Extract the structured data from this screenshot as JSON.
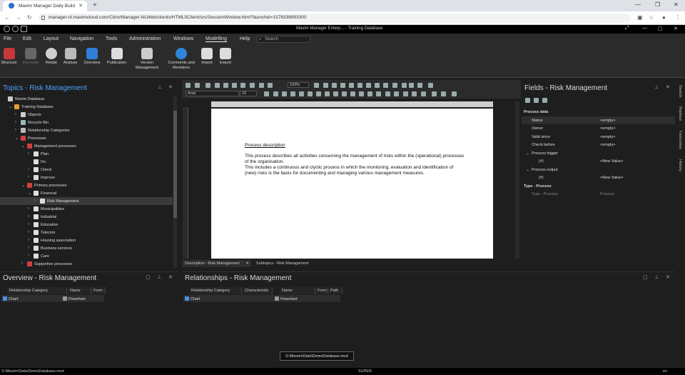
{
  "browser": {
    "tab_title": "Mavim Manager Daily Build",
    "url": "manager-nl.mavimcloud.com/Citrix/Manager-NLWeb/clients/HTML5Client/src/SessionWindow.html?launchid=1578338993300"
  },
  "app": {
    "title": "Mavim Manager Enterp... - Training Database",
    "menu": [
      "File",
      "Edit",
      "Layout",
      "Navigation",
      "Tools",
      "Administration",
      "Windows",
      "Modelling",
      "Help"
    ],
    "active_menu": "Modelling",
    "search_placeholder": "Search",
    "ribbon": [
      {
        "label": "Structure",
        "has_menu": true
      },
      {
        "label": "Decorate",
        "disabled": true
      },
      {
        "label": "Relate",
        "has_menu": true
      },
      {
        "label": "Analyse",
        "has_menu": true
      },
      {
        "label": "Overview",
        "has_menu": true
      },
      {
        "label": "Publication",
        "has_menu": true
      },
      {
        "label": "Version Management",
        "has_menu": true
      },
      {
        "label": "Comments and Revisions",
        "has_menu": true
      },
      {
        "label": "Import",
        "has_menu": true
      },
      {
        "label": "Export",
        "has_menu": true
      }
    ]
  },
  "topics": {
    "title_prefix": "Topics - ",
    "title_topic": "Risk Management",
    "tree": [
      {
        "label": "Mavim Database",
        "level": 0,
        "expanded": null,
        "icon": "database-icon",
        "color": "#c9c9c9"
      },
      {
        "label": "Training Database",
        "level": 1,
        "expanded": true,
        "icon": "folder-icon",
        "color": "#e0a030"
      },
      {
        "label": "Objects",
        "level": 2,
        "expanded": false,
        "icon": "objects-icon",
        "color": "#cfcfcf"
      },
      {
        "label": "Recycle Bin",
        "level": 2,
        "expanded": false,
        "icon": "recycle-bin-icon",
        "color": "#9bb"
      },
      {
        "label": "Relationship Categories",
        "level": 2,
        "expanded": false,
        "icon": "categories-icon",
        "color": "#bbb"
      },
      {
        "label": "Processes",
        "level": 2,
        "expanded": true,
        "icon": "process-icon",
        "color": "#d04040"
      },
      {
        "label": "Management processes",
        "level": 3,
        "expanded": true,
        "icon": "process-icon",
        "color": "#d04040"
      },
      {
        "label": "Plan",
        "level": 4,
        "expanded": false,
        "icon": "page-icon",
        "color": "#ddd"
      },
      {
        "label": "Do",
        "level": 4,
        "expanded": null,
        "icon": "page-icon",
        "color": "#ddd"
      },
      {
        "label": "Check",
        "level": 4,
        "expanded": false,
        "icon": "page-icon",
        "color": "#ddd"
      },
      {
        "label": "Improve",
        "level": 4,
        "expanded": false,
        "icon": "page-icon",
        "color": "#ddd"
      },
      {
        "label": "Primary processes",
        "level": 3,
        "expanded": true,
        "icon": "process-icon",
        "color": "#d04040"
      },
      {
        "label": "Financial",
        "level": 4,
        "expanded": true,
        "icon": "page-icon",
        "color": "#ddd"
      },
      {
        "label": "Risk Management",
        "level": 5,
        "expanded": false,
        "icon": "page-icon",
        "color": "#ddd",
        "selected": true
      },
      {
        "label": "Municipalities",
        "level": 4,
        "expanded": false,
        "icon": "page-icon",
        "color": "#ddd"
      },
      {
        "label": "Industrial",
        "level": 4,
        "expanded": false,
        "icon": "page-icon",
        "color": "#ddd"
      },
      {
        "label": "Education",
        "level": 4,
        "expanded": false,
        "icon": "page-icon",
        "color": "#ddd"
      },
      {
        "label": "Telecom",
        "level": 4,
        "expanded": false,
        "icon": "page-icon",
        "color": "#ddd"
      },
      {
        "label": "Housing association",
        "level": 4,
        "expanded": false,
        "icon": "page-icon",
        "color": "#ddd"
      },
      {
        "label": "Business services",
        "level": 4,
        "expanded": false,
        "icon": "page-icon",
        "color": "#ddd"
      },
      {
        "label": "Care",
        "level": 4,
        "expanded": false,
        "icon": "page-icon",
        "color": "#ddd"
      },
      {
        "label": "Supportive processes",
        "level": 3,
        "expanded": false,
        "icon": "process-icon",
        "color": "#d04040"
      }
    ]
  },
  "editor": {
    "font": "Arial",
    "size": "10",
    "zoom": "100%",
    "heading": "Process description",
    "paragraph1": "This process describes all activities concerning the management of risks within the (operational) processes of the organisation.",
    "paragraph2": "This includes a continuous and clyclic process in which the monitoring, evaluation and identification of (new) risks is the basis for documenting and managing various management measures.",
    "tabs": [
      {
        "label": "Description - Risk Management",
        "active": true
      },
      {
        "label": "Subtopics - Risk Management",
        "active": false
      }
    ]
  },
  "fields": {
    "title": "Fields - Risk Management",
    "rows": [
      {
        "key": "Process data",
        "value": "",
        "type": "section"
      },
      {
        "key": "Status",
        "value": "<empty>",
        "type": "field",
        "highlight": true
      },
      {
        "key": "Owner",
        "value": "<empty>",
        "type": "field"
      },
      {
        "key": "Valid since",
        "value": "<empty>",
        "type": "field"
      },
      {
        "key": "Check before",
        "value": "<empty>",
        "type": "field"
      },
      {
        "key": "Process trigger",
        "value": "",
        "type": "group"
      },
      {
        "key": "(#)",
        "value": "<New Value>",
        "type": "subfield"
      },
      {
        "key": "Process output",
        "value": "",
        "type": "group"
      },
      {
        "key": "(#)",
        "value": "<New Value>",
        "type": "subfield"
      },
      {
        "key": "Type - Process",
        "value": "",
        "type": "section"
      },
      {
        "key": "Type - Process",
        "value": "Process",
        "type": "dim"
      }
    ],
    "side_tabs": [
      "Search",
      "Replace",
      "Favourites",
      "History"
    ]
  },
  "overview": {
    "title": "Overview - Risk Management",
    "columns": [
      "Relationship Category",
      "Name",
      "From"
    ],
    "rows": [
      {
        "category": "Chart",
        "name": "Flowchart",
        "from": ""
      }
    ]
  },
  "relationships": {
    "title": "Relationships - Risk Management",
    "columns": [
      "Relationship Category",
      "Characteristic",
      "Name",
      "From",
      "Path"
    ],
    "rows": [
      {
        "category": "Chart",
        "characteristic": "",
        "name": "Flowchart",
        "from": "",
        "path": ""
      }
    ]
  },
  "tooltip": "S:\\Mavim\\Data\\DemoDatabase.mvd",
  "status": {
    "left": "S:\\Mavim\\Data\\DemoDatabase.mvd",
    "center": "SUPER",
    "right": "en"
  }
}
